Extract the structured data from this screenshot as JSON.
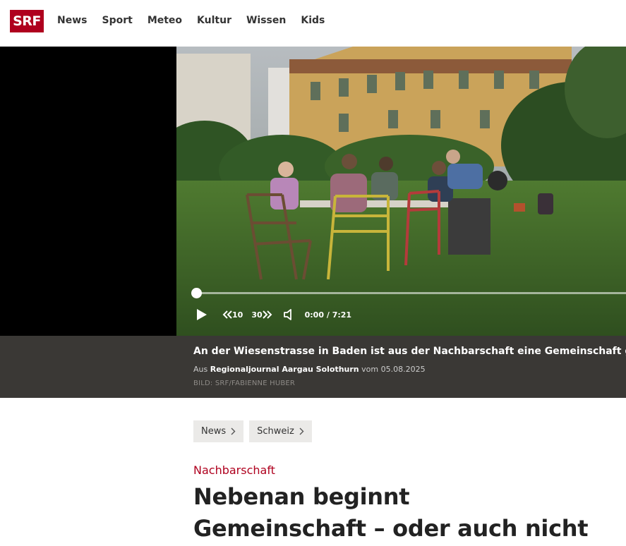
{
  "header": {
    "logo_text": "SRF",
    "nav": [
      "News",
      "Sport",
      "Meteo",
      "Kultur",
      "Wissen",
      "Kids"
    ]
  },
  "player": {
    "skip_back_label": "10",
    "skip_forward_label": "30",
    "current_time": "0:00",
    "time_separator": "/",
    "duration": "7:21",
    "progress": 0
  },
  "caption": {
    "title": "An der Wiesenstrasse in Baden ist aus der Nachbarschaft eine Gemeinschaft geworden",
    "source_prefix": "Aus",
    "source_program": "Regionaljournal Aargau Solothurn",
    "source_date_prefix": "vom",
    "source_date": "05.08.2025",
    "credit": "BILD: SRF/FABIENNE HUBER"
  },
  "breadcrumbs": [
    "News",
    "Schweiz"
  ],
  "article": {
    "kicker": "Nachbarschaft",
    "headline": "Nebenan beginnt Gemeinschaft – oder auch nicht"
  },
  "colors": {
    "brand": "#af001e",
    "caption_bg": "#3a3835"
  },
  "icons": [
    "play-icon",
    "rewind-icon",
    "forward-icon",
    "volume-icon",
    "chevron-right-icon"
  ]
}
